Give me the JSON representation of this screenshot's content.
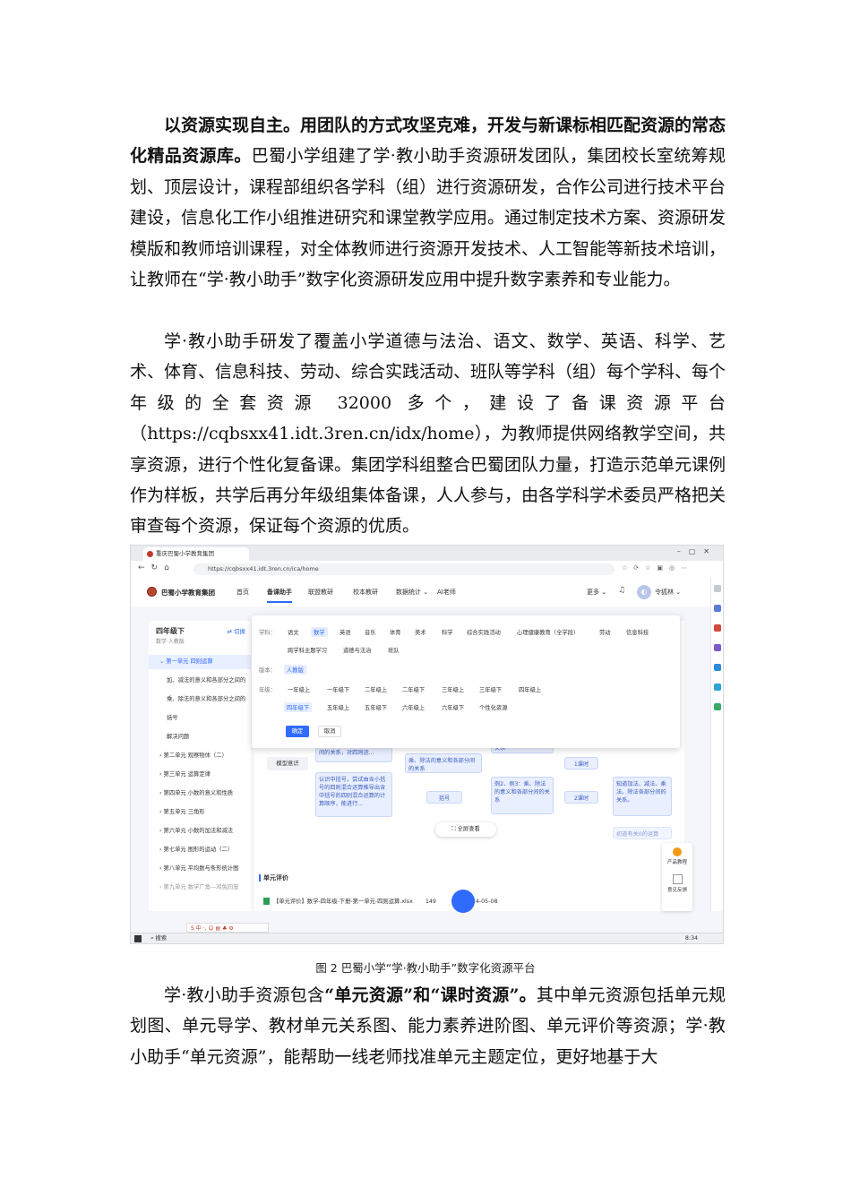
{
  "paragraphs": {
    "p1_bold": "以资源实现自主。用团队的方式攻坚克难，开发与新课标相匹配资源的常态化精品资源库。",
    "p1_rest": "巴蜀小学组建了学·教小助手资源研发团队，集团校长室统筹规划、顶层设计，课程部组织各学科（组）进行资源研发，合作公司进行技术平台建设，信息化工作小组推进研究和课堂教学应用。通过制定技术方案、资源研发模版和教师培训课程，对全体教师进行资源开发技术、人工智能等新技术培训，让教师在“学·教小助手”数字化资源研发应用中提升数字素养和专业能力。",
    "p2": "学·教小助手研发了覆盖小学道德与法治、语文、数学、英语、科学、艺术、体育、信息科技、劳动、综合实践活动、班队等学科（组）每个学科、每个年级的全套资源 32000 多个，建设了备课资源平台（https://cqbsxx41.idt.3ren.cn/idx/home），为教师提供网络教学空间，共享资源，进行个性化复备课。集团学科组整合巴蜀团队力量，打造示范单元课例作为样板，共学后再分年级组集体备课，人人参与，由各学科学术委员严格把关审查每个资源，保证每个资源的优质。",
    "p3_a": "学·教小助手资源包含",
    "p3_bold": "“单元资源”和“课时资源”。",
    "p3_b": "其中单元资源包括单元规划图、单元导学、教材单元关系图、能力素养进阶图、单元评价等资源；学·教小助手“单元资源”，能帮助一线老师找准单元主题定位，更好地基于大"
  },
  "caption": "图 2 巴蜀小学“学·教小助手”数字化资源平台",
  "screenshot": {
    "tab_title": "重庆巴蜀小学教育集团",
    "url": "https://cqbsxx41.idt.3ren.cn/ica/home",
    "brand": "巴蜀小学教育集团",
    "menu": [
      "首页",
      "备课助手",
      "联盟教研",
      "校本教研",
      "数据统计 ⌄",
      "AI老师"
    ],
    "more": "更多 ⌄",
    "user": "令狐林 ⌄",
    "sidebar": {
      "title": "四年级下",
      "switch": "⇄ 切换",
      "subtitle": "数学·人教版",
      "items": [
        "⌄ 第一单元 四则运算",
        "加、减法的意义和各部分之间的",
        "乘、除法的意义和各部分之间的",
        "括号",
        "解决问题",
        "› 第二单元 观察物体（二）",
        "› 第三单元 运算定律",
        "› 第四单元 小数的意义和性质",
        "› 第五单元 三角形",
        "› 第六单元 小数的加法和减法",
        "› 第七单元 图形的运动（二）",
        "› 第八单元 平均数与条形统计图",
        "› 第九单元 数学广角—鸡兔同笼"
      ]
    },
    "filter": {
      "subject_label": "学科：",
      "subjects": [
        "语文",
        "数学",
        "英语",
        "音乐",
        "体育",
        "美术",
        "科学",
        "综合实践活动",
        "心理健康教育（全学段）",
        "劳动",
        "信息科技"
      ],
      "subjects2": [
        "跨学科主题学习",
        "道德与法治",
        "班队"
      ],
      "edition_label": "版本：",
      "edition": "人教版",
      "grade_label": "年级：",
      "grades": [
        "一年级上",
        "一年级下",
        "二年级上",
        "二年级下",
        "三年级上",
        "三年级下",
        "四年级上"
      ],
      "grades2": [
        "四年级下",
        "五年级上",
        "五年级下",
        "六年级上",
        "六年级下",
        "个性化资源"
      ],
      "ok": "确定",
      "cancel": "取消"
    },
    "mindmap": {
      "model": "模型意识",
      "n1": "义，掌握四则运算中各部分间的关系，对四则运...",
      "n2": "认识中括号，尝试由含小括号的四则混合运算推导出含中括号的四则混合运算的计算顺序，能进行...",
      "n3": "乘、除法的意义和各部分间的关系",
      "n4": "括号",
      "n5": "关系",
      "n6": "例2、例3：乘、除法的意义和各部分间的关系",
      "n7": "1课时",
      "n8": "2课时",
      "n9": "知道加法、减法、乘法、除法各部分间的关系。",
      "n10": "初道有关0的运算",
      "full_view": "⛶ 全屏查看"
    },
    "unit_eval": "单元评价",
    "file": "【单元评价】数学-四年级-下册-第一单元-四则运算.xlsx",
    "file_size": "149",
    "file_date": "2024-05-08",
    "help1": "产品教程",
    "help2": "意见反馈",
    "ime": "S 中 ·, ☺ ▤ ♣ ⚙",
    "search": "⌕ 搜索",
    "clock": "8:34"
  }
}
